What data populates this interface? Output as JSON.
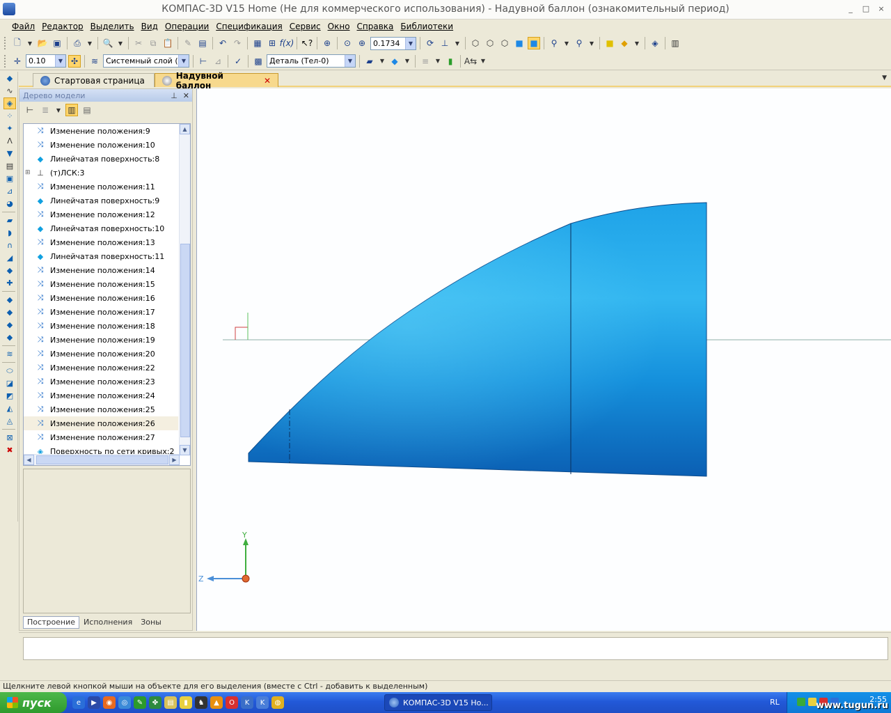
{
  "window": {
    "title": "КОМПАС-3D V15 Home (Не для коммерческого использования) - Надувной баллон (ознакомительный период)",
    "controls": [
      "_",
      "□",
      "×"
    ]
  },
  "menu": [
    "Файл",
    "Редактор",
    "Выделить",
    "Вид",
    "Операции",
    "Спецификация",
    "Сервис",
    "Окно",
    "Справка",
    "Библиотеки"
  ],
  "toolbar1": {
    "zoom_value": "0.1734"
  },
  "toolbar2": {
    "step_value": "0.10",
    "layer": "Системный слой (0)",
    "part": "Деталь (Тел-0)"
  },
  "tabs": [
    {
      "label": "Стартовая страница"
    },
    {
      "label": "Надувной баллон",
      "active": true
    }
  ],
  "tree_panel": {
    "title": "Дерево модели",
    "items": [
      {
        "label": "Изменение положения:9",
        "icon": "reposition-icon"
      },
      {
        "label": "Изменение положения:10",
        "icon": "reposition-icon"
      },
      {
        "label": "Линейчатая поверхность:8",
        "icon": "ruled-surface-icon"
      },
      {
        "label": "(т)ЛСК:3",
        "icon": "lcs-icon",
        "expandable": true
      },
      {
        "label": "Изменение положения:11",
        "icon": "reposition-icon"
      },
      {
        "label": "Линейчатая поверхность:9",
        "icon": "ruled-surface-icon"
      },
      {
        "label": "Изменение положения:12",
        "icon": "reposition-icon"
      },
      {
        "label": "Линейчатая поверхность:10",
        "icon": "ruled-surface-icon"
      },
      {
        "label": "Изменение положения:13",
        "icon": "reposition-icon"
      },
      {
        "label": "Линейчатая поверхность:11",
        "icon": "ruled-surface-icon"
      },
      {
        "label": "Изменение положения:14",
        "icon": "reposition-icon"
      },
      {
        "label": "Изменение положения:15",
        "icon": "reposition-icon"
      },
      {
        "label": "Изменение положения:16",
        "icon": "reposition-icon"
      },
      {
        "label": "Изменение положения:17",
        "icon": "reposition-icon"
      },
      {
        "label": "Изменение положения:18",
        "icon": "reposition-icon"
      },
      {
        "label": "Изменение положения:19",
        "icon": "reposition-icon"
      },
      {
        "label": "Изменение положения:20",
        "icon": "reposition-icon"
      },
      {
        "label": "Изменение положения:22",
        "icon": "reposition-icon"
      },
      {
        "label": "Изменение положения:23",
        "icon": "reposition-icon"
      },
      {
        "label": "Изменение положения:24",
        "icon": "reposition-icon"
      },
      {
        "label": "Изменение положения:25",
        "icon": "reposition-icon"
      },
      {
        "label": "Изменение положения:26",
        "icon": "reposition-icon",
        "highlighted": true
      },
      {
        "label": "Изменение положения:27",
        "icon": "reposition-icon"
      },
      {
        "label": "Поверхность по сети кривых:2",
        "icon": "network-surface-icon"
      }
    ],
    "bottom_tabs": [
      "Построение",
      "Исполнения",
      "Зоны"
    ]
  },
  "viewport": {
    "axis_y": "Y",
    "axis_z": "Z",
    "colors": {
      "surface_light": "#35b8f0",
      "surface_dark": "#0d5fb0",
      "axis_line": "#8fb0a8",
      "triad_y": "#3fae3f",
      "triad_z": "#4a8fd8"
    }
  },
  "status": {
    "text": "Щелкните левой кнопкой мыши на объекте для его выделения (вместе с Ctrl - добавить к выделенным)"
  },
  "taskbar": {
    "start": "пуск",
    "task": "КОМПАС-3D V15 Ho...",
    "lang": "RL",
    "clock": "2:55",
    "watermark": "www.tugun.ru"
  }
}
